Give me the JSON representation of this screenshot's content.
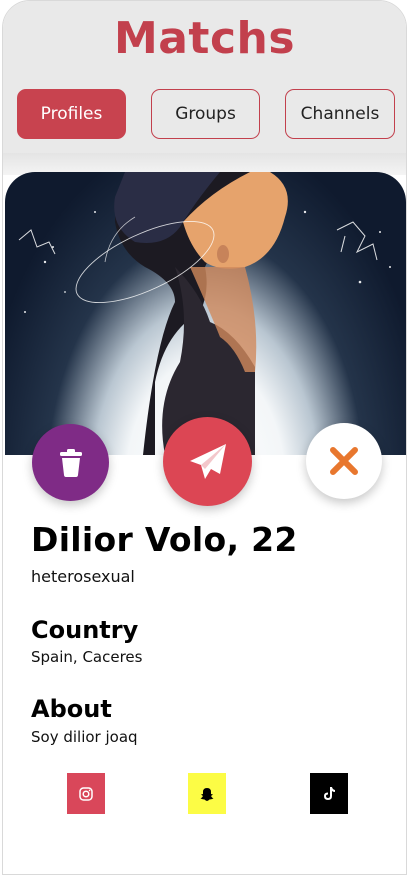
{
  "header": {
    "title": "Matchs",
    "tabs": [
      {
        "label": "Profiles",
        "active": true
      },
      {
        "label": "Groups",
        "active": false
      },
      {
        "label": "Channels",
        "active": false
      }
    ]
  },
  "profile": {
    "name_age": "Dilior Volo, 22",
    "orientation": "heterosexual",
    "country_heading": "Country",
    "country": "Spain, Caceres",
    "about_heading": "About",
    "about": "Soy dilior joaq"
  },
  "actions": [
    {
      "icon": "trash-icon",
      "color": "#7f2b86"
    },
    {
      "icon": "paper-plane-icon",
      "color": "#dc4654"
    },
    {
      "icon": "close-icon",
      "color": "#e8772e"
    }
  ],
  "social": [
    {
      "icon": "instagram-icon",
      "color": "#d9475a"
    },
    {
      "icon": "snapchat-icon",
      "color": "#fcfc45"
    },
    {
      "icon": "tiktok-icon",
      "color": "#000000"
    }
  ],
  "colors": {
    "brand": "#c2404d",
    "accent": "#dc4654"
  }
}
